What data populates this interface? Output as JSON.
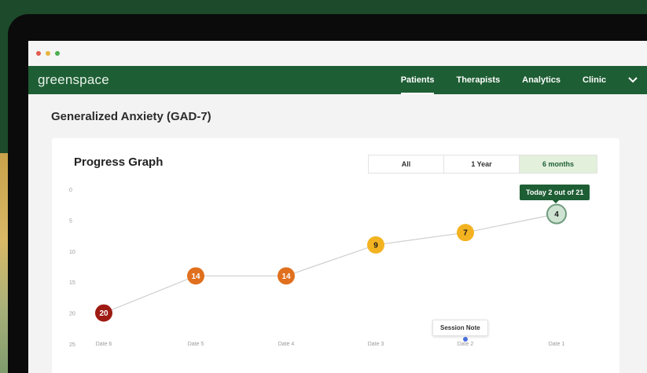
{
  "app": {
    "brand": "greenspace"
  },
  "window_dots": [
    "#e25b4e",
    "#e8b33f",
    "#4caf50"
  ],
  "nav": {
    "items": [
      {
        "label": "Patients",
        "active": true
      },
      {
        "label": "Therapists",
        "active": false
      },
      {
        "label": "Analytics",
        "active": false
      },
      {
        "label": "Clinic",
        "active": false
      }
    ]
  },
  "page": {
    "title": "Generalized Anxiety (GAD-7)"
  },
  "graph_card": {
    "title": "Progress Graph",
    "ranges": [
      {
        "label": "All",
        "selected": false
      },
      {
        "label": "1 Year",
        "selected": false
      },
      {
        "label": "6 months",
        "selected": true
      }
    ],
    "tooltip": "Today 2 out of 21",
    "session_note": "Session Note"
  },
  "chart_data": {
    "type": "line",
    "y_ticks": [
      "0",
      "5",
      "10",
      "15",
      "20",
      "25"
    ],
    "ylim": [
      0,
      25
    ],
    "y_inverted": true,
    "categories": [
      "Date 6",
      "Date 5",
      "Date 4",
      "Date 3",
      "Date 2",
      "Date 1"
    ],
    "values": [
      20,
      14,
      14,
      9,
      7,
      4
    ],
    "point_colors": [
      "#9e1b14",
      "#e0701e",
      "#e0701e",
      "#f3b321",
      "#f3b321",
      "#cfe3d3"
    ],
    "grid": false
  },
  "colors": {
    "brand_green": "#1e5e34",
    "line": "#cfcfcf",
    "note_dot": "#4a6fe0"
  }
}
